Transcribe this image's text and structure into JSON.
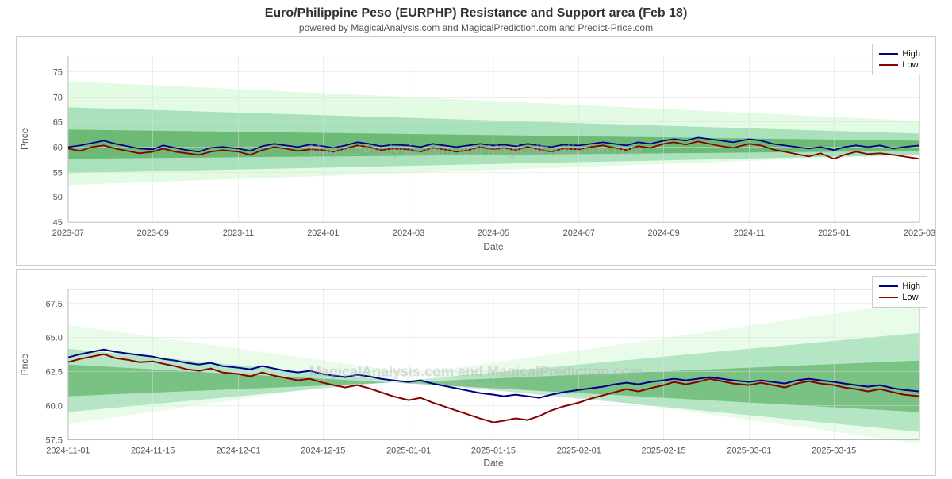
{
  "title": "Euro/Philippine Peso (EURPHP) Resistance and Support area (Feb 18)",
  "subtitle": "powered by MagicalAnalysis.com and MagicalPrediction.com and Predict-Price.com",
  "chart1": {
    "y_labels": [
      "45",
      "50",
      "55",
      "60",
      "65",
      "70",
      "75"
    ],
    "x_labels": [
      "2023-07",
      "2023-09",
      "2023-11",
      "2024-01",
      "2024-03",
      "2024-05",
      "2024-07",
      "2024-09",
      "2024-11",
      "2025-01",
      "2025-03"
    ],
    "y_axis_title": "Price",
    "x_axis_title": "Date",
    "legend": {
      "high_label": "High",
      "low_label": "Low",
      "high_color": "#00008B",
      "low_color": "#8B0000"
    }
  },
  "chart2": {
    "y_labels": [
      "57.5",
      "60.0",
      "62.5",
      "65.0",
      "67.5"
    ],
    "x_labels": [
      "2024-11-01",
      "2024-11-15",
      "2024-12-01",
      "2024-12-15",
      "2025-01-01",
      "2025-01-15",
      "2025-02-01",
      "2025-02-15",
      "2025-03-01",
      "2025-03-15"
    ],
    "y_axis_title": "Price",
    "x_axis_title": "Date",
    "legend": {
      "high_label": "High",
      "low_label": "Low",
      "high_color": "#00008B",
      "low_color": "#8B0000"
    }
  },
  "watermark": "MagicalAnalysis.com and MagicalPrediction.com"
}
